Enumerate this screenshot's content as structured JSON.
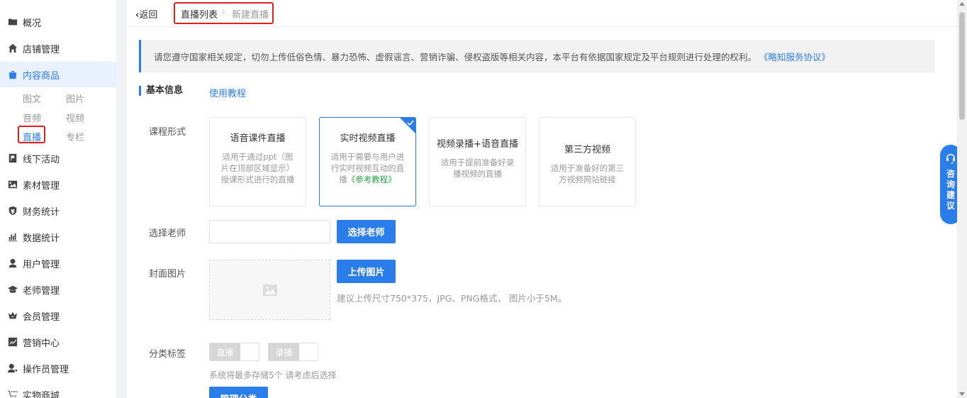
{
  "sidebar": {
    "items": [
      {
        "label": "概况",
        "icon": "overview-icon"
      },
      {
        "label": "店铺管理",
        "icon": "store-icon"
      },
      {
        "label": "内容商品",
        "icon": "bag-icon"
      },
      {
        "label": "线下活动",
        "icon": "flag-icon"
      },
      {
        "label": "素材管理",
        "icon": "image-icon"
      },
      {
        "label": "财务统计",
        "icon": "finance-icon"
      },
      {
        "label": "数据统计",
        "icon": "bar-chart-icon"
      },
      {
        "label": "用户管理",
        "icon": "user-icon"
      },
      {
        "label": "老师管理",
        "icon": "graduation-cap-icon"
      },
      {
        "label": "会员管理",
        "icon": "vip-icon"
      },
      {
        "label": "营销中心",
        "icon": "trend-icon"
      },
      {
        "label": "操作员管理",
        "icon": "operator-icon"
      },
      {
        "label": "实物商城",
        "icon": "cart-icon"
      }
    ],
    "sub_items": [
      "图文",
      "图片",
      "音频",
      "视频",
      "直播",
      "专栏"
    ]
  },
  "header": {
    "back_label": "返回",
    "breadcrumb": [
      "直播列表",
      "新建直播"
    ]
  },
  "notice": {
    "text": "请您遵守国家相关规定，切勿上传低俗色情、暴力恐怖、虚假谣言、营销诈骗、侵权盗版等相关内容，本平台有依据国家规定及平台规则进行处理的权利。",
    "link": "《略知服务协议》"
  },
  "section": {
    "title": "基本信息",
    "tutorial_link": "使用教程"
  },
  "form": {
    "course_form_label": "课程形式",
    "course_cards": [
      {
        "title": "语音课件直播",
        "desc": "适用于通过ppt（图片在顶部区域显示）授课形式进行的直播"
      },
      {
        "title": "实时视频直播",
        "desc": "适用于需要与用户进行实时视频互动的直播",
        "link": "《参考教程》"
      },
      {
        "title": "视频录播+语音直播",
        "desc": "适用于提前准备好录播视频的直播"
      },
      {
        "title": "第三方视频",
        "desc": "适用于准备好的第三方视频网站链接"
      }
    ],
    "teacher_label": "选择老师",
    "teacher_value": "",
    "teacher_button": "选择老师",
    "cover_label": "封面图片",
    "upload_button": "上传图片",
    "upload_hint": "建议上传尺寸750*375，JPG、PNG格式， 图片小于5M。",
    "tag_label": "分类标签",
    "tags": [
      "直播",
      "录播"
    ],
    "tag_hint": "系统将最多存储5个 请考虑后选择",
    "manage_button": "管理分类"
  },
  "consult": {
    "label": "咨询建议"
  },
  "colors": {
    "accent": "#2b7de9",
    "highlight_box": "#e02020",
    "link_green": "#29a342"
  }
}
